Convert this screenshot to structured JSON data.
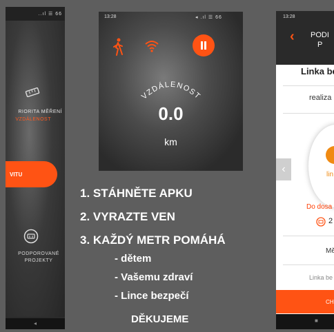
{
  "colors": {
    "accent": "#ff5314",
    "background": "#5e5e5e"
  },
  "left_phone": {
    "status": "..ıl ☰ 66",
    "priority_label": "RIORITA MĚŘENÍ",
    "priority_value": "VZDÁLENOST",
    "button_label": "VITU",
    "supported_label_1": "PODPOROVANÉ",
    "supported_label_2": "PROJEKTY",
    "nav_back": "◂",
    "icons": [
      "ruler-icon",
      "coin-icon"
    ]
  },
  "middle_phone": {
    "status_time": "13:28",
    "status_right": "◂ .ıl ☰ 66",
    "arc_label": "VZDÁLENOST",
    "distance_value": "0.0",
    "distance_unit": "km",
    "icons": [
      "walking-icon",
      "wifi-icon",
      "pause-icon"
    ]
  },
  "right_phone": {
    "status_time": "13:28",
    "back": "‹",
    "title_line1": "PODI",
    "title_line2": "P",
    "line_heading": "Linka be",
    "realization": "realiza",
    "circle_label": "lin",
    "prev": "‹",
    "dosa_label": "Do dosa",
    "coin_value": "2",
    "me_label": "Mě",
    "linka_small": "Linka be",
    "button_label": "CH",
    "nav_stop": "■"
  },
  "instructions": {
    "step1": "1. STÁHNĚTE APKU",
    "step2": "2. VYRAZTE VEN",
    "step3": "3. KAŽDÝ METR POMÁHÁ",
    "sub1": "- dětem",
    "sub2": "- Vašemu zdraví",
    "sub3": "- Lince bezpečí",
    "thanks": "DĚKUJEME"
  }
}
